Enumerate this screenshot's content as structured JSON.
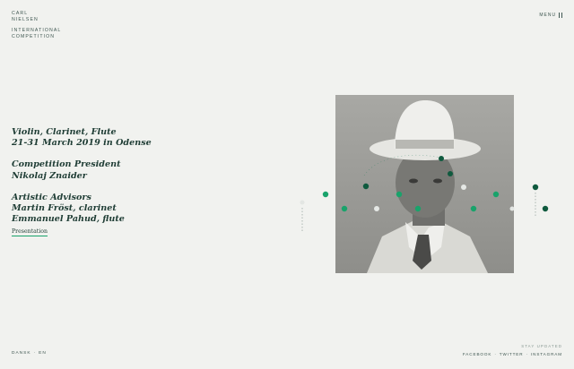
{
  "logo": {
    "lines": [
      "CARL",
      "NIELSEN",
      "INTERNATIONAL",
      "COMPETITION"
    ]
  },
  "menu": {
    "label": "MENU"
  },
  "info": {
    "disciplines": "Violin, Clarinet, Flute",
    "dates": "21-31 March 2019 in Odense",
    "president_heading": "Competition President",
    "president_name": "Nikolaj Znaider",
    "advisors_heading": "Artistic Advisors",
    "advisor_1": "Martin Fröst, clarinet",
    "advisor_2": "Emmanuel Pahud, flute"
  },
  "presentation_link": "Presentation",
  "language": {
    "da": "DANSK",
    "separator": "·",
    "en": "EN"
  },
  "footer": {
    "stay_updated": "STAY UPDATED",
    "links": [
      "FACEBOOK",
      "TWITTER",
      "INSTAGRAM"
    ],
    "separator": "·"
  },
  "colors": {
    "accent": "#19a36b",
    "dark_accent": "#0f5a3e",
    "text": "#1f3d35"
  },
  "icons": {
    "menu": "menu-bars-icon"
  }
}
